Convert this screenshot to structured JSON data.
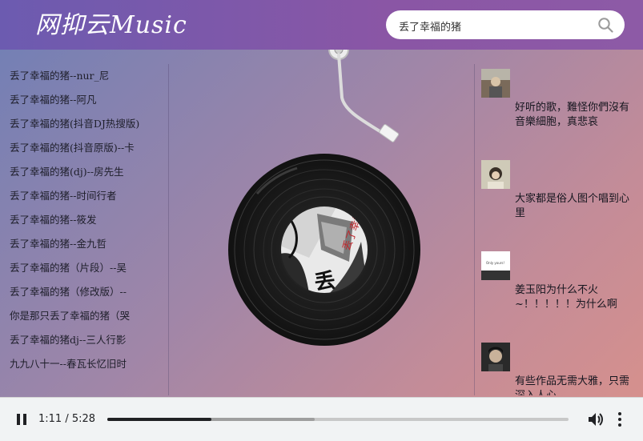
{
  "app": {
    "logo": "网抑云Music"
  },
  "search": {
    "value": "丢了幸福的猪"
  },
  "songs": [
    "丢了幸福的猪--nur_尼",
    "丢了幸福的猪--阿凡",
    "丢了幸福的猪(抖音DJ热搜版)",
    "丢了幸福的猪(抖音原版)--卡",
    "丢了幸福的猪(dj)--房先生",
    "丢了幸福的猪--时间行者",
    "丢了幸福的猪--筱发",
    "丢了幸福的猪--金九哲",
    "丢了幸福的猪（片段）--吴",
    "丢了幸福的猪（修改版）--",
    "你是那只丢了幸福的猪（哭",
    "丢了幸福的猪dj--三人行影",
    "九九八十一--春瓦长忆旧时"
  ],
  "album": {
    "cover_text": "丢了幸福的猪"
  },
  "comments": [
    {
      "text": "好听的歌，難怪你們沒有音樂細胞，真悲哀"
    },
    {
      "text": "大家都是俗人图个唱到心里"
    },
    {
      "text": "姜玉阳为什么不火~！！！！！为什么啊",
      "avatar_text": "Only yours!"
    },
    {
      "text": "有些作品无需大雅，只需深入人心。"
    }
  ],
  "player": {
    "current_time": "1:11",
    "duration": "5:28",
    "time_display": "1:11 / 5:28",
    "progress": 0.226,
    "buffered": 0.45,
    "state": "playing"
  },
  "colors": {
    "header_start": "#6c5bb0",
    "header_end": "#8d5aa6",
    "bg_start": "#6f7fb6",
    "bg_end": "#d9918b",
    "controls_bg": "#f1f3f4"
  }
}
